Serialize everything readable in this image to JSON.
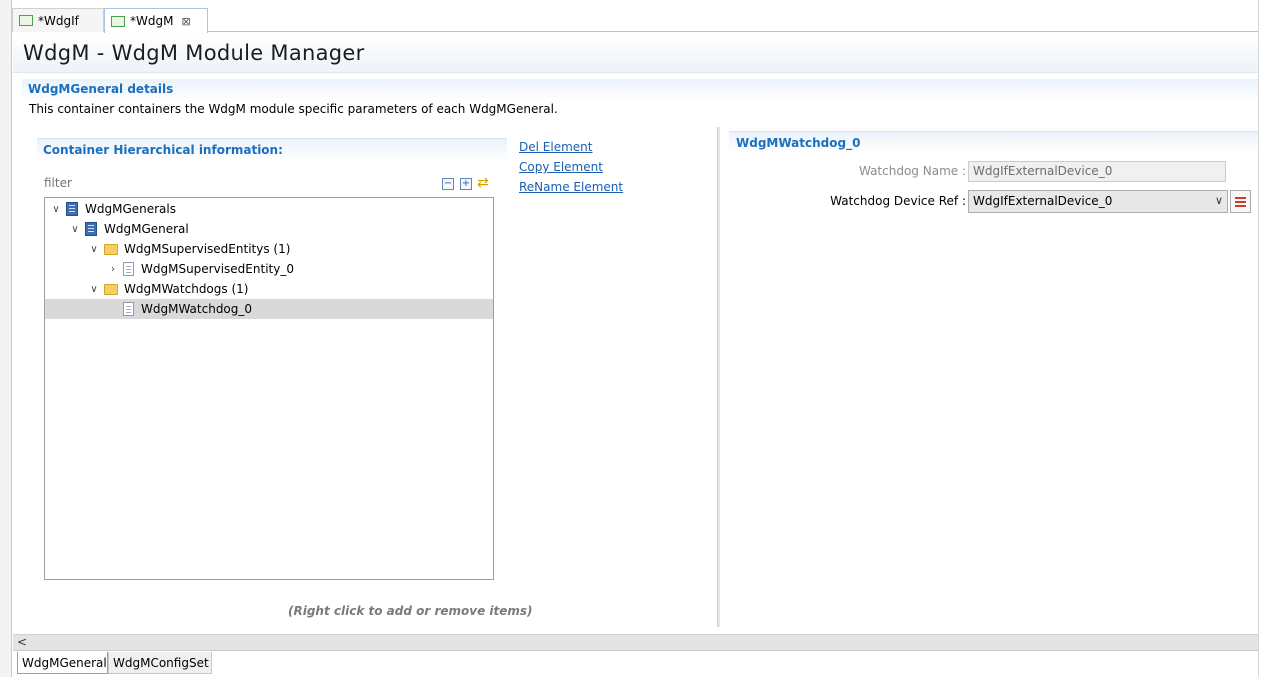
{
  "editor_tabs": [
    {
      "label": "*WdgIf"
    },
    {
      "label": "*WdgM",
      "close": "⊠"
    }
  ],
  "form": {
    "title": "WdgM - WdgM Module Manager"
  },
  "details": {
    "title": "WdgMGeneral details",
    "description": "This container containers the WdgM module specific parameters of each WdgMGeneral."
  },
  "hierarchy": {
    "title": "Container Hierarchical information:",
    "filter_placeholder": "filter",
    "tree": [
      {
        "label": "WdgMGenerals",
        "twisty": "∨"
      },
      {
        "label": "WdgMGeneral",
        "twisty": "∨"
      },
      {
        "label": "WdgMSupervisedEntitys (1)",
        "twisty": "∨"
      },
      {
        "label": "WdgMSupervisedEntity_0",
        "twisty": "›"
      },
      {
        "label": "WdgMWatchdogs (1)",
        "twisty": "∨"
      },
      {
        "label": "WdgMWatchdog_0",
        "twisty": ""
      }
    ],
    "hint": "(Right click to add or remove items)"
  },
  "actions": {
    "del": "Del Element",
    "copy": "Copy Element",
    "rename": "ReName Element"
  },
  "watchdog": {
    "title": "WdgMWatchdog_0",
    "name_label": "Watchdog Name :",
    "name_value": "WdgIfExternalDevice_0",
    "ref_label": "Watchdog Device Ref :",
    "ref_value": "WdgIfExternalDevice_0"
  },
  "scroll": {
    "left_arrow": "<"
  },
  "page_tabs": [
    {
      "label": "WdgMGeneral"
    },
    {
      "label": "WdgMConfigSet"
    }
  ],
  "colors": {
    "section_title": "#1a6fbf",
    "link": "#1a5fb4",
    "selection": "#d9d9d9"
  }
}
